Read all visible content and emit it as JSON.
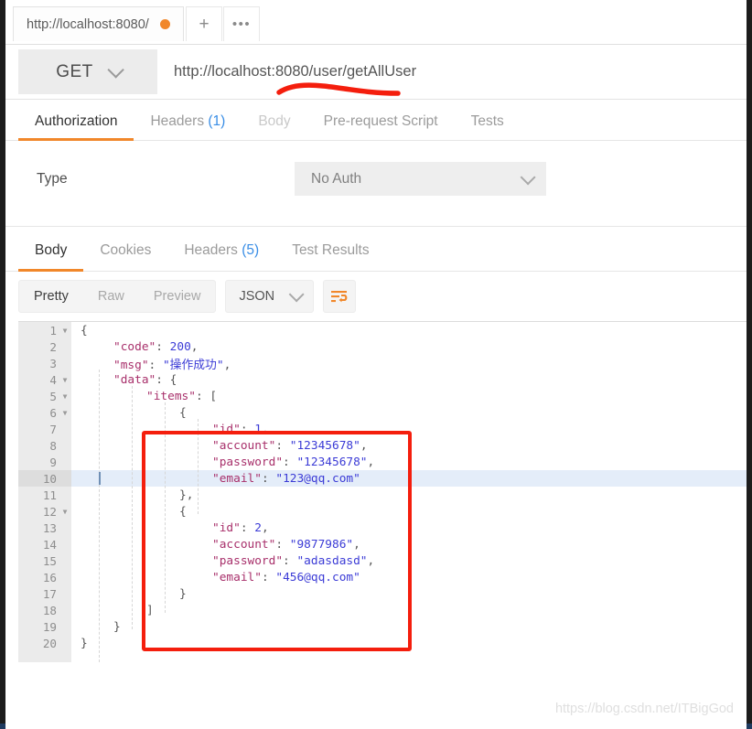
{
  "window": {
    "request_tab": {
      "label": "http://localhost:8080/",
      "unsaved_indicator": "unsaved-dot"
    },
    "new_tab_icon": "plus-icon",
    "more_tabs_icon": "ellipsis-icon"
  },
  "request": {
    "method": "GET",
    "method_chevron_icon": "chevron-down-icon",
    "url": "http://localhost:8080/user/getAllUser",
    "tabs": [
      {
        "label": "Authorization",
        "count": "",
        "active": true,
        "dim": false
      },
      {
        "label": "Headers",
        "count": "(1)",
        "active": false,
        "dim": false
      },
      {
        "label": "Body",
        "count": "",
        "active": false,
        "dim": true
      },
      {
        "label": "Pre-request Script",
        "count": "",
        "active": false,
        "dim": false
      },
      {
        "label": "Tests",
        "count": "",
        "active": false,
        "dim": false
      }
    ],
    "auth": {
      "type_label": "Type",
      "type_value": "No Auth",
      "type_chevron_icon": "chevron-down-icon"
    }
  },
  "response": {
    "tabs": [
      {
        "label": "Body",
        "count": "",
        "active": true,
        "dim": false
      },
      {
        "label": "Cookies",
        "count": "",
        "active": false,
        "dim": false
      },
      {
        "label": "Headers",
        "count": "(5)",
        "active": false,
        "dim": false
      },
      {
        "label": "Test Results",
        "count": "",
        "active": false,
        "dim": false
      }
    ],
    "view_modes": [
      {
        "label": "Pretty",
        "active": true
      },
      {
        "label": "Raw",
        "active": false
      },
      {
        "label": "Preview",
        "active": false
      }
    ],
    "format": {
      "label": "JSON",
      "chevron_icon": "chevron-down-icon"
    },
    "wrap_button_icon": "word-wrap-icon",
    "code_lines": [
      {
        "num": "1",
        "fold": true,
        "indent": 0,
        "tokens": [
          {
            "t": "brace",
            "v": "{"
          }
        ]
      },
      {
        "num": "2",
        "fold": false,
        "indent": 1,
        "tokens": [
          {
            "t": "key",
            "v": "\"code\""
          },
          {
            "t": "punc",
            "v": ": "
          },
          {
            "t": "num",
            "v": "200"
          },
          {
            "t": "punc",
            "v": ","
          }
        ]
      },
      {
        "num": "3",
        "fold": false,
        "indent": 1,
        "tokens": [
          {
            "t": "key",
            "v": "\"msg\""
          },
          {
            "t": "punc",
            "v": ": "
          },
          {
            "t": "str",
            "v": "\"操作成功\""
          },
          {
            "t": "punc",
            "v": ","
          }
        ]
      },
      {
        "num": "4",
        "fold": true,
        "indent": 1,
        "tokens": [
          {
            "t": "key",
            "v": "\"data\""
          },
          {
            "t": "punc",
            "v": ": "
          },
          {
            "t": "brace",
            "v": "{"
          }
        ]
      },
      {
        "num": "5",
        "fold": true,
        "indent": 2,
        "tokens": [
          {
            "t": "key",
            "v": "\"items\""
          },
          {
            "t": "punc",
            "v": ": "
          },
          {
            "t": "brace",
            "v": "["
          }
        ]
      },
      {
        "num": "6",
        "fold": true,
        "indent": 3,
        "tokens": [
          {
            "t": "brace",
            "v": "{"
          }
        ]
      },
      {
        "num": "7",
        "fold": false,
        "indent": 4,
        "tokens": [
          {
            "t": "key",
            "v": "\"id\""
          },
          {
            "t": "punc",
            "v": ": "
          },
          {
            "t": "num",
            "v": "1"
          },
          {
            "t": "punc",
            "v": ","
          }
        ]
      },
      {
        "num": "8",
        "fold": false,
        "indent": 4,
        "tokens": [
          {
            "t": "key",
            "v": "\"account\""
          },
          {
            "t": "punc",
            "v": ": "
          },
          {
            "t": "str",
            "v": "\"12345678\""
          },
          {
            "t": "punc",
            "v": ","
          }
        ]
      },
      {
        "num": "9",
        "fold": false,
        "indent": 4,
        "tokens": [
          {
            "t": "key",
            "v": "\"password\""
          },
          {
            "t": "punc",
            "v": ": "
          },
          {
            "t": "str",
            "v": "\"12345678\""
          },
          {
            "t": "punc",
            "v": ","
          }
        ]
      },
      {
        "num": "10",
        "fold": false,
        "indent": 4,
        "highlight": true,
        "cursor": true,
        "tokens": [
          {
            "t": "key",
            "v": "\"email\""
          },
          {
            "t": "punc",
            "v": ": "
          },
          {
            "t": "str",
            "v": "\"123@qq.com\""
          }
        ]
      },
      {
        "num": "11",
        "fold": false,
        "indent": 3,
        "tokens": [
          {
            "t": "brace",
            "v": "},"
          }
        ]
      },
      {
        "num": "12",
        "fold": true,
        "indent": 3,
        "tokens": [
          {
            "t": "brace",
            "v": "{"
          }
        ]
      },
      {
        "num": "13",
        "fold": false,
        "indent": 4,
        "tokens": [
          {
            "t": "key",
            "v": "\"id\""
          },
          {
            "t": "punc",
            "v": ": "
          },
          {
            "t": "num",
            "v": "2"
          },
          {
            "t": "punc",
            "v": ","
          }
        ]
      },
      {
        "num": "14",
        "fold": false,
        "indent": 4,
        "tokens": [
          {
            "t": "key",
            "v": "\"account\""
          },
          {
            "t": "punc",
            "v": ": "
          },
          {
            "t": "str",
            "v": "\"9877986\""
          },
          {
            "t": "punc",
            "v": ","
          }
        ]
      },
      {
        "num": "15",
        "fold": false,
        "indent": 4,
        "tokens": [
          {
            "t": "key",
            "v": "\"password\""
          },
          {
            "t": "punc",
            "v": ": "
          },
          {
            "t": "str",
            "v": "\"adasdasd\""
          },
          {
            "t": "punc",
            "v": ","
          }
        ]
      },
      {
        "num": "16",
        "fold": false,
        "indent": 4,
        "tokens": [
          {
            "t": "key",
            "v": "\"email\""
          },
          {
            "t": "punc",
            "v": ": "
          },
          {
            "t": "str",
            "v": "\"456@qq.com\""
          }
        ]
      },
      {
        "num": "17",
        "fold": false,
        "indent": 3,
        "tokens": [
          {
            "t": "brace",
            "v": "}"
          }
        ]
      },
      {
        "num": "18",
        "fold": false,
        "indent": 2,
        "tokens": [
          {
            "t": "brace",
            "v": "]"
          }
        ]
      },
      {
        "num": "19",
        "fold": false,
        "indent": 1,
        "tokens": [
          {
            "t": "brace",
            "v": "}"
          }
        ]
      },
      {
        "num": "20",
        "fold": false,
        "indent": 0,
        "tokens": [
          {
            "t": "brace",
            "v": "}"
          }
        ]
      }
    ]
  },
  "annotations": {
    "highlight_color": "#f41e0d",
    "url_underline": "red-underline-on-url",
    "response_box": "red-rectangle-around-items-array"
  },
  "watermark": {
    "text": "https://blog.csdn.net/ITBigGod"
  }
}
